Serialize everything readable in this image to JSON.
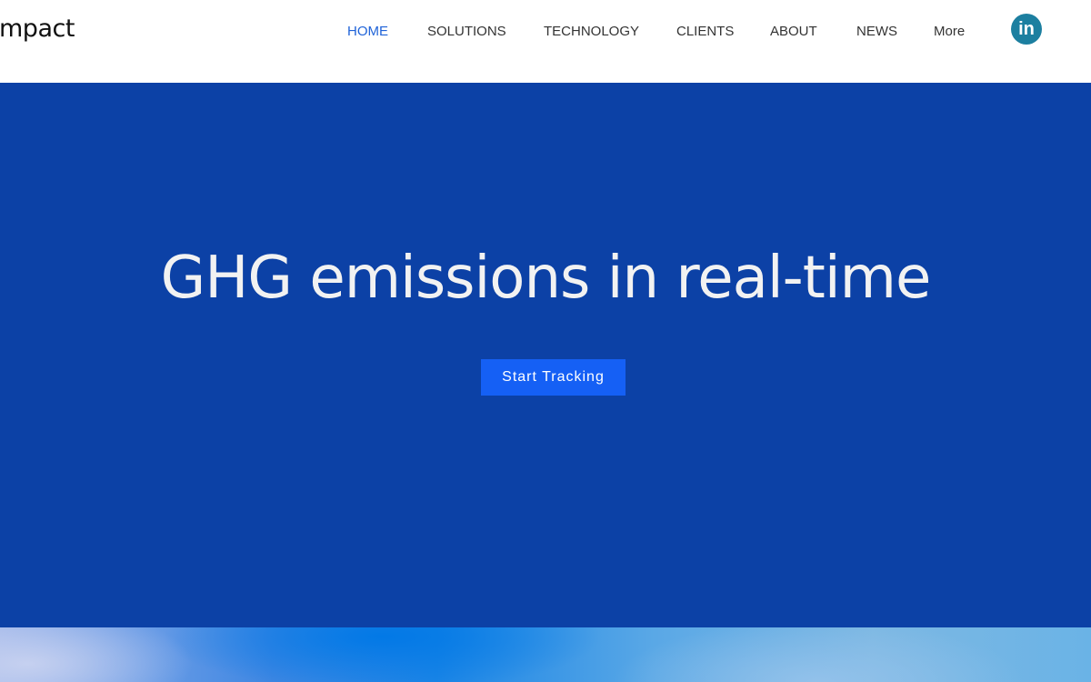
{
  "brand": {
    "logo_text": "mpact"
  },
  "nav": {
    "items": [
      {
        "label": "HOME",
        "active": true
      },
      {
        "label": "SOLUTIONS",
        "active": false
      },
      {
        "label": "TECHNOLOGY",
        "active": false
      },
      {
        "label": "CLIENTS",
        "active": false
      },
      {
        "label": "ABOUT",
        "active": false
      },
      {
        "label": "NEWS",
        "active": false
      },
      {
        "label": "More",
        "active": false
      }
    ],
    "social_icon": "linkedin-icon",
    "social_glyph": "in"
  },
  "hero": {
    "title": "GHG emissions in real-time",
    "cta_label": "Start Tracking"
  },
  "colors": {
    "hero_background": "#0c41a6",
    "cta_background": "#1560f5",
    "nav_active": "#1f63d8",
    "linkedin": "#1c7fa0"
  }
}
